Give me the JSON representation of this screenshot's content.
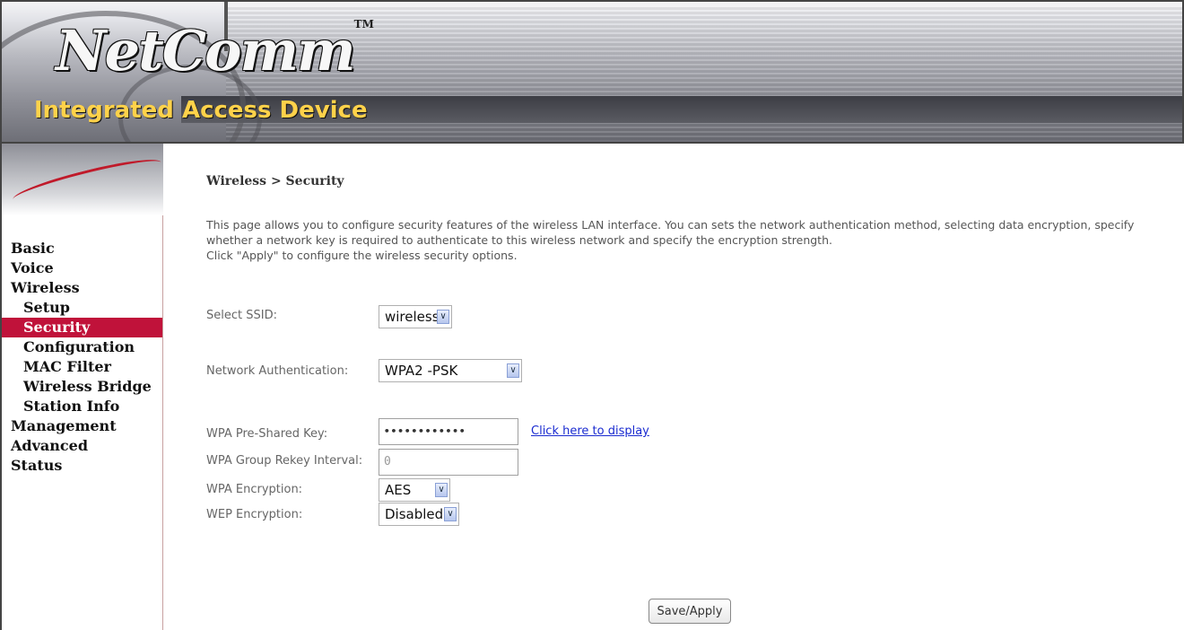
{
  "header": {
    "brand": "NetComm",
    "trademark": "TM",
    "tagline": "Integrated Access Device"
  },
  "sidebar": {
    "items": [
      {
        "label": "Basic"
      },
      {
        "label": "Voice"
      },
      {
        "label": "Wireless"
      },
      {
        "label": "Setup"
      },
      {
        "label": "Security"
      },
      {
        "label": "Configuration"
      },
      {
        "label": "MAC Filter"
      },
      {
        "label": "Wireless Bridge"
      },
      {
        "label": "Station Info"
      },
      {
        "label": "Management"
      },
      {
        "label": "Advanced"
      },
      {
        "label": "Status"
      }
    ],
    "active": "Security"
  },
  "main": {
    "breadcrumb": "Wireless > Security",
    "description_line1": "This page allows you to configure security features of the wireless LAN interface. You can sets the network authentication method, selecting data encryption, specify whether a network key is required to authenticate to this wireless network and specify the encryption strength.",
    "description_line2": "Click \"Apply\" to configure the wireless security options.",
    "form": {
      "ssid_label": "Select SSID:",
      "ssid_value": "wireless",
      "auth_label": "Network Authentication:",
      "auth_value": "WPA2 -PSK",
      "psk_label": "WPA Pre-Shared Key:",
      "psk_value": "••••••••••••",
      "display_link": "Click here to display",
      "rekey_label": "WPA Group Rekey Interval:",
      "rekey_value": "0",
      "wpa_enc_label": "WPA Encryption:",
      "wpa_enc_value": "AES",
      "wep_enc_label": "WEP Encryption:",
      "wep_enc_value": "Disabled",
      "arrow_glyph": "∨",
      "save_label": "Save/Apply"
    }
  },
  "colors": {
    "active_nav": "#c0123a",
    "link": "#1a2bd0",
    "tagline": "#ffd24a"
  }
}
